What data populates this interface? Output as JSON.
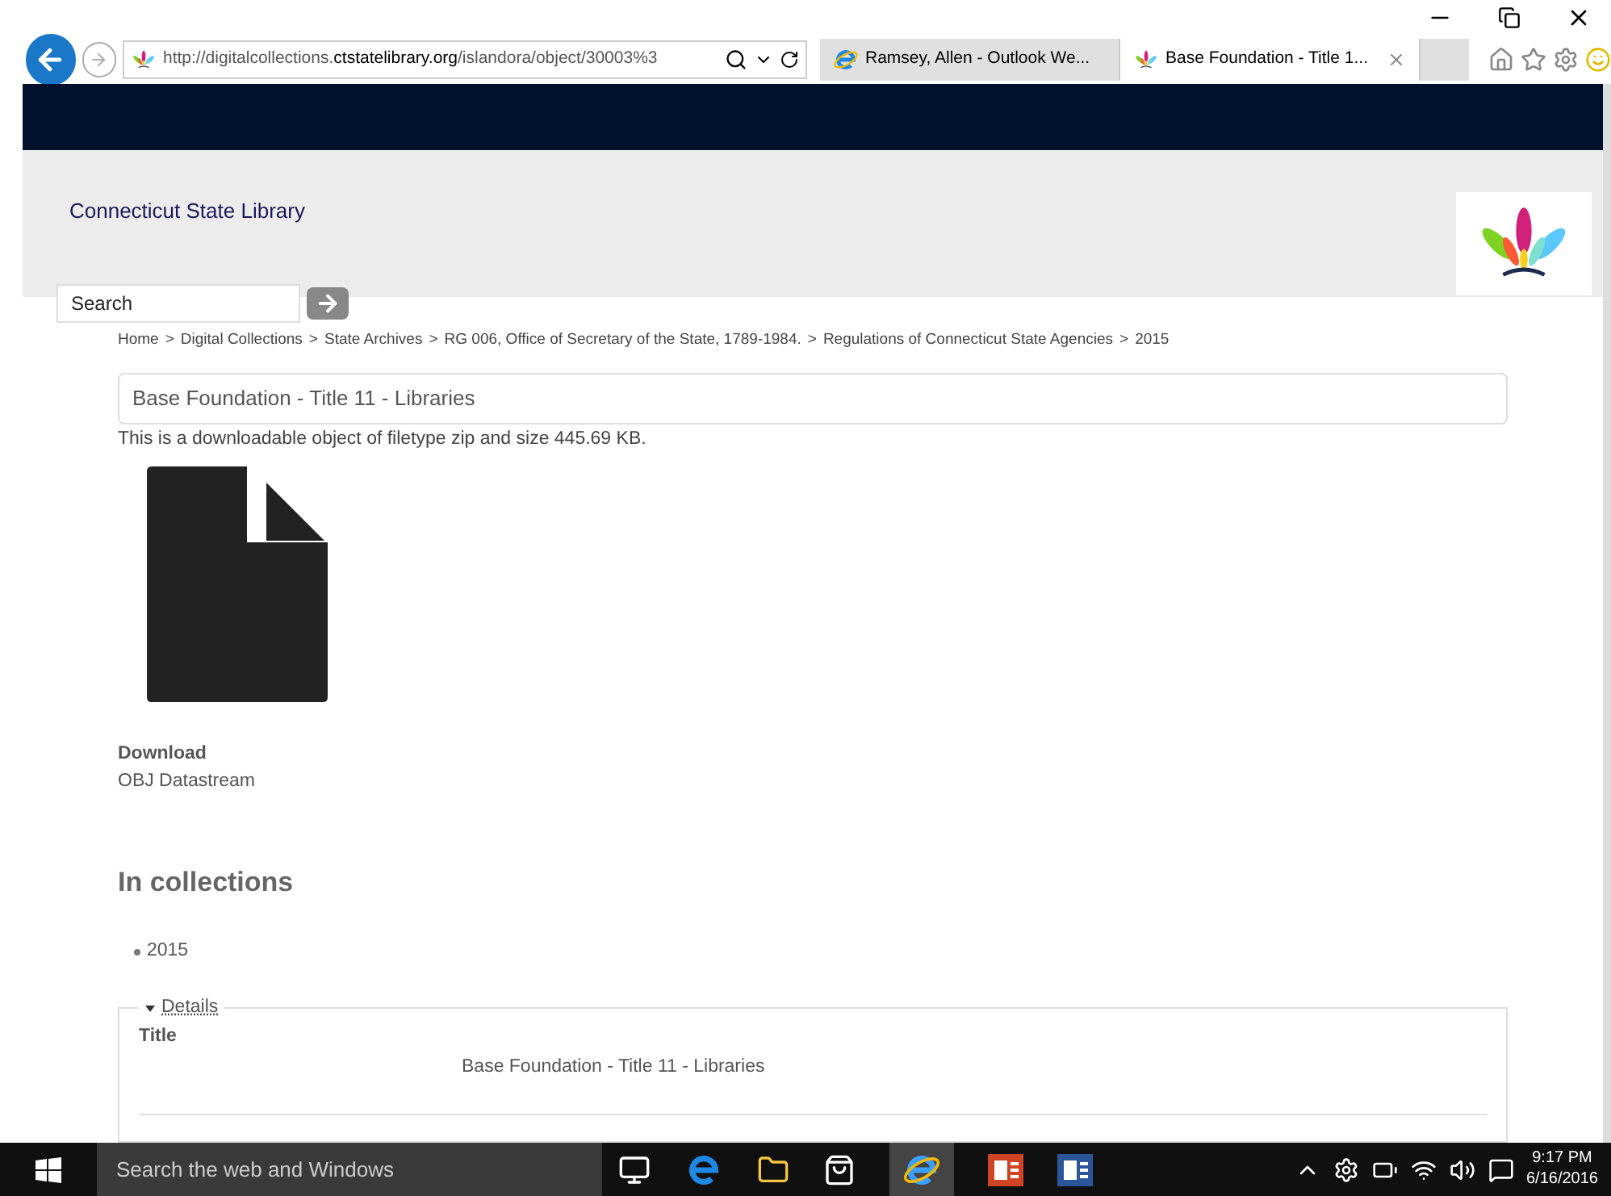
{
  "browser": {
    "url_prefix": "http://digitalcollections.",
    "url_domain": "ctstatelibrary.org",
    "url_path": "/islandora/object/30003%3",
    "tabs": [
      {
        "label": "Ramsey, Allen - Outlook We...",
        "selected": false,
        "kind": "ie"
      },
      {
        "label": "Base Foundation - Title 1...",
        "selected": true,
        "kind": "site"
      }
    ]
  },
  "site": {
    "name": "Connecticut State Library",
    "search": {
      "placeholder": "Search"
    }
  },
  "breadcrumbs": [
    "Home",
    "Digital Collections",
    "State Archives",
    "RG 006, Office of Secretary of the State, 1789-1984.",
    "Regulations of Connecticut State Agencies",
    "2015"
  ],
  "breadcrumb_separator": ">",
  "object": {
    "title": "Base Foundation - Title 11 - Libraries",
    "description": "This is a downloadable object of filetype zip and size 445.69 KB.",
    "download_label": "Download",
    "download_link": "OBJ Datastream"
  },
  "collections": {
    "heading": "In collections",
    "items": [
      "2015"
    ]
  },
  "details": {
    "toggle": "Details",
    "expanded": true,
    "fields": [
      {
        "label": "Title",
        "value": "Base Foundation - Title 11 - Libraries"
      }
    ]
  },
  "taskbar": {
    "search_placeholder": "Search the web and Windows",
    "time": "9:17 PM",
    "date": "6/16/2016"
  }
}
